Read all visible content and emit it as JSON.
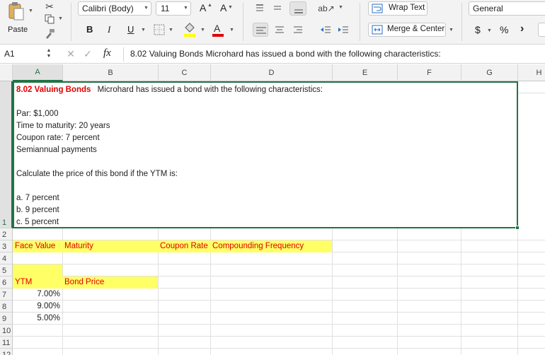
{
  "ribbon": {
    "paste_label": "Paste",
    "font_name": "Calibri (Body)",
    "font_size": "11",
    "grow_font": "A",
    "shrink_font": "A",
    "bold": "B",
    "italic": "I",
    "underline": "U",
    "wrap_text": "Wrap Text",
    "merge_center": "Merge & Center",
    "number_format": "General",
    "currency_symbol": "$",
    "percent_symbol": "%",
    "comma_symbol": "›",
    "font_color_hex": "#e00000",
    "fill_color_hex": "#ffff00"
  },
  "formula_bar": {
    "name_box": "A1",
    "fx": "fx",
    "content": "8.02 Valuing Bonds   Microhard has issued a bond with the following characteristics:"
  },
  "columns": [
    "A",
    "B",
    "C",
    "D",
    "E",
    "F",
    "G",
    "H"
  ],
  "rows": [
    "1",
    "2",
    "3",
    "4",
    "5",
    "6",
    "7",
    "8",
    "9",
    "10",
    "11",
    "12"
  ],
  "cells": {
    "a1_title": "8.02 Valuing Bonds",
    "a1_intro": "Microhard has issued a bond with the following characteristics:",
    "par": "Par: $1,000",
    "time": "Time to maturity: 20 years",
    "coupon": "Coupon rate: 7 percent",
    "semi": "Semiannual payments",
    "calc": "Calculate the price of this bond if the YTM is:",
    "opt_a": "a. 7 percent",
    "opt_b": "b. 9 percent",
    "opt_c": "c. 5 percent",
    "a3": "Face Value",
    "b3": "Maturity",
    "c3": "Coupon Rate",
    "d3": "Compounding Frequency",
    "a6": "YTM",
    "b6": "Bond Price",
    "a7": "7.00%",
    "a8": "9.00%",
    "a9": "5.00%"
  },
  "colors": {
    "accent": "#217346",
    "highlight": "#ffff66",
    "title_red": "#e00000"
  }
}
